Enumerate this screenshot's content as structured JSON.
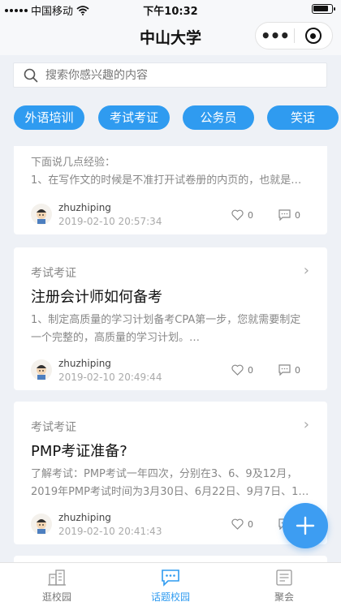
{
  "status_bar": {
    "carrier": "中国移动",
    "time": "下午10:32"
  },
  "nav": {
    "title": "中山大学",
    "more_icon": "ellipsis-icon",
    "close_icon": "target-icon"
  },
  "search": {
    "placeholder": "搜索你感兴趣的内容",
    "icon": "search-icon"
  },
  "tags": [
    "外语培训",
    "考试考证",
    "公务员",
    "笑话"
  ],
  "posts": [
    {
      "category": "",
      "title": "",
      "excerpt_line1": "下面说几点经验：",
      "excerpt_line2": "1、在写作文的时候是不准打开试卷册的内页的，也就是…",
      "author": "zhuzhiping",
      "time": "2019-02-10 20:57:34",
      "likes": "0",
      "comments": "0"
    },
    {
      "category": "考试考证",
      "title": "注册会计师如何备考",
      "excerpt_line1": "1、制定高质量的学习计划备考CPA第一步，您就需要制定",
      "excerpt_line2": "一个完整的，高质量的学习计划。…",
      "author": "zhuzhiping",
      "time": "2019-02-10 20:49:44",
      "likes": "0",
      "comments": "0"
    },
    {
      "category": "考试考证",
      "title": "PMP考证准备?",
      "excerpt_line1": "了解考试：PMP考试一年四次，分别在3、6、9及12月，",
      "excerpt_line2": "2019年PMP考试时间为3月30日、6月22日、9月7日、1…",
      "author": "zhuzhiping",
      "time": "2019-02-10 20:41:43",
      "likes": "0",
      "comments": "0"
    }
  ],
  "tab_bar": {
    "items": [
      {
        "label": "逛校园",
        "icon": "campus-building-icon",
        "active": false
      },
      {
        "label": "话题校园",
        "icon": "chat-bubble-icon",
        "active": true
      },
      {
        "label": "聚会",
        "icon": "newspaper-icon",
        "active": false
      }
    ]
  },
  "colors": {
    "accent": "#2f9bf0",
    "background": "#eef1f6"
  }
}
